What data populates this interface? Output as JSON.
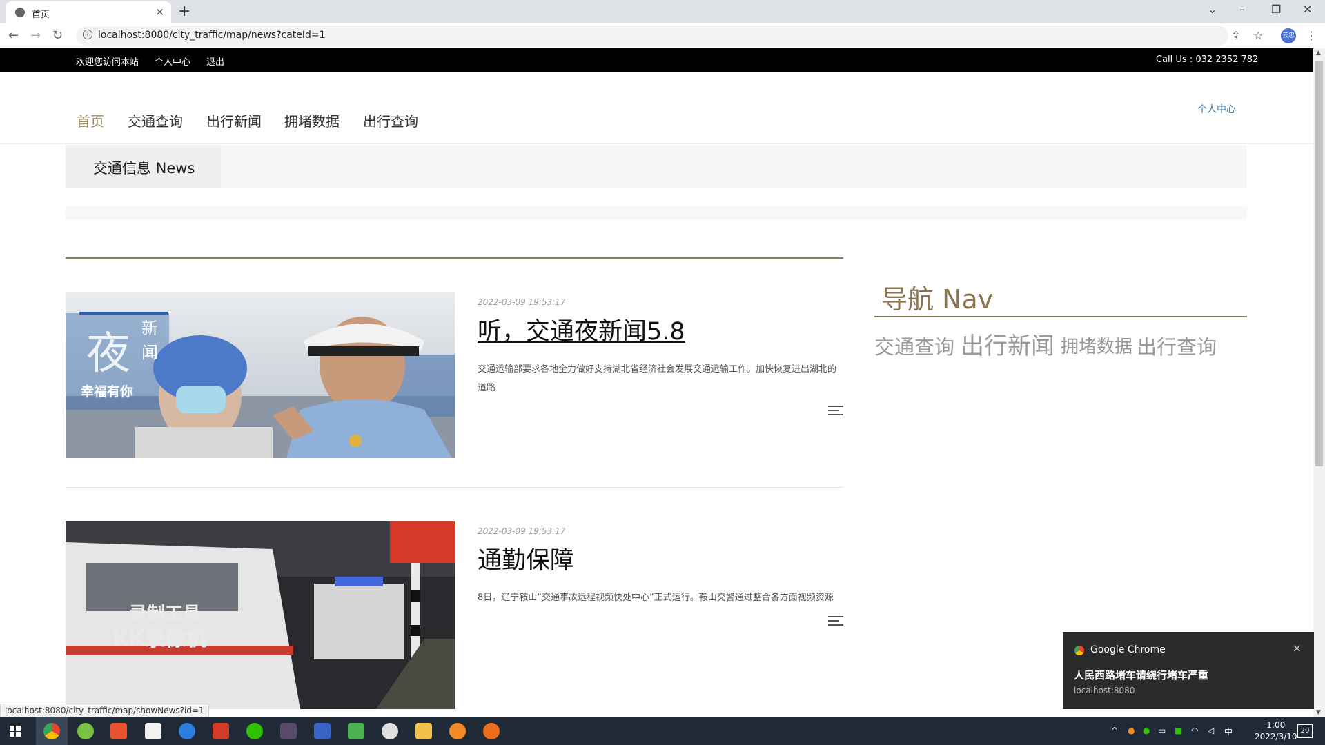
{
  "browser": {
    "tab_title": "首页",
    "tab_close": "×",
    "new_tab": "+",
    "url": "localhost:8080/city_traffic/map/news?cateId=1",
    "profile_label": "云忠"
  },
  "topbar": {
    "welcome": "欢迎您访问本站",
    "personal_center": "个人中心",
    "logout": "退出",
    "phone": "Call Us : 032 2352 782"
  },
  "nav": {
    "items": [
      "首页",
      "交通查询",
      "出行新闻",
      "拥堵数据",
      "出行查询"
    ],
    "personal_link": "个人中心"
  },
  "banner": {
    "title": "交通信息 News"
  },
  "news": [
    {
      "date": "2022-03-09 19:53:17",
      "title": "听，交通夜新闻5.8",
      "desc": "交通运输部要求各地全力做好支持湖北省经济社会发展交通运输工作。加快恢复进出湖北的道路",
      "image_caption": [
        "新",
        "闻",
        "幸福有你"
      ]
    },
    {
      "date": "2022-03-09 19:53:17",
      "title": "通勤保障",
      "desc": "8日，辽宁鞍山“交通事故远程视频快处中心”正式运行。鞍山交警通过整合各方面视频资源",
      "image_caption": [
        "录制工具",
        "KK录像机"
      ]
    }
  ],
  "sidebar": {
    "title": "导航 Nav",
    "links": [
      "交通查询",
      "出行新闻",
      "拥堵数据",
      "出行查询"
    ]
  },
  "notification": {
    "app": "Google Chrome",
    "message": "人民西路堵车请绕行堵车严重",
    "source": "localhost:8080",
    "close": "×"
  },
  "status_url": "localhost:8080/city_traffic/map/showNews?id=1",
  "taskbar": {
    "lang": "中",
    "time": "1:00",
    "date": "2022/3/10",
    "notif_count": "20"
  }
}
